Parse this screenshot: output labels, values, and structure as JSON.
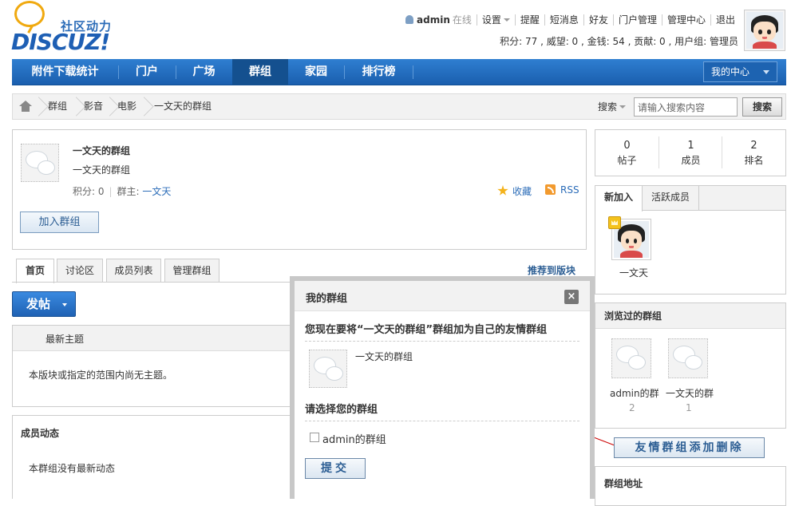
{
  "logo": {
    "tagline": "社区动力",
    "brand": "DISCUZ!"
  },
  "topnav": {
    "username": "admin",
    "status": "在线",
    "items": [
      "设置",
      "提醒",
      "短消息",
      "好友",
      "门户管理",
      "管理中心",
      "退出"
    ]
  },
  "stats": "积分: 77 , 威望: 0 , 金钱: 54 , 贡献: 0 , 用户组: 管理员",
  "mainnav": {
    "items": [
      "附件下载统计",
      "门户",
      "广场",
      "群组",
      "家园",
      "排行榜"
    ],
    "active": "群组",
    "my_center": "我的中心"
  },
  "breadcrumb": [
    "群组",
    "影音",
    "电影",
    "一文天的群组"
  ],
  "search": {
    "label": "搜索",
    "placeholder": "请输入搜索内容",
    "button": "搜索"
  },
  "group": {
    "name": "一文天的群组",
    "description": "一文天的群组",
    "points_label": "积分: 0",
    "owner_label": "群主:",
    "owner": "一文天",
    "favorite": "收藏",
    "rss": "RSS",
    "join_button": "加入群组"
  },
  "tabs": [
    "首页",
    "讨论区",
    "成员列表",
    "管理群组"
  ],
  "recommend": "推荐到版块",
  "post_button": "发帖",
  "latest": {
    "header": "最新主题",
    "empty": "本版块或指定的范围内尚无主题。"
  },
  "activity": {
    "header": "成员动态",
    "empty": "本群组没有最新动态"
  },
  "counts": [
    {
      "value": "0",
      "label": "帖子"
    },
    {
      "value": "1",
      "label": "成员"
    },
    {
      "value": "2",
      "label": "排名"
    }
  ],
  "members": {
    "tabs": [
      "新加入",
      "活跃成员"
    ],
    "name": "一文天"
  },
  "browsed": {
    "header": "浏览过的群组",
    "groups": [
      {
        "name": "admin的群",
        "count": "2"
      },
      {
        "name": "一文天的群",
        "count": "1"
      }
    ]
  },
  "address": {
    "header": "群组地址"
  },
  "annotation": "友情群组添加删除",
  "dialog": {
    "title": "我的群组",
    "close": "×",
    "question": "您现在要将“一文天的群组”群组加为自己的友情群组",
    "group_name": "一文天的群组",
    "choose": "请选择您的群组",
    "option": "admin的群组",
    "submit": "提交"
  },
  "colors": {
    "nav_blue": "#1a5fae",
    "link_blue": "#2b6cb8",
    "annotation_arrow": "#cc0000"
  }
}
